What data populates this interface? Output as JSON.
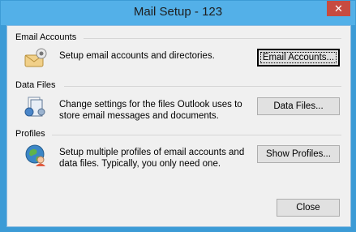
{
  "window": {
    "title": "Mail Setup - 123",
    "close_glyph": "✕"
  },
  "email_accounts": {
    "group_label": "Email Accounts",
    "description": "Setup email accounts and directories.",
    "button_label": "Email Accounts...",
    "icon": "mail-icon"
  },
  "data_files": {
    "group_label": "Data Files",
    "description_line1": "Change settings for the files Outlook uses to",
    "description_line2": "store email messages and documents.",
    "button_label": "Data Files...",
    "icon": "data-files-icon"
  },
  "profiles": {
    "group_label": "Profiles",
    "description_line1": "Setup multiple profiles of email accounts and",
    "description_line2": "data files. Typically, you only need one.",
    "button_label": "Show Profiles...",
    "icon": "profiles-icon"
  },
  "footer": {
    "close_label": "Close"
  },
  "colors": {
    "titlebar": "#53b0e8",
    "close_button": "#c74b40",
    "dialog_bg": "#f0f0f0"
  }
}
